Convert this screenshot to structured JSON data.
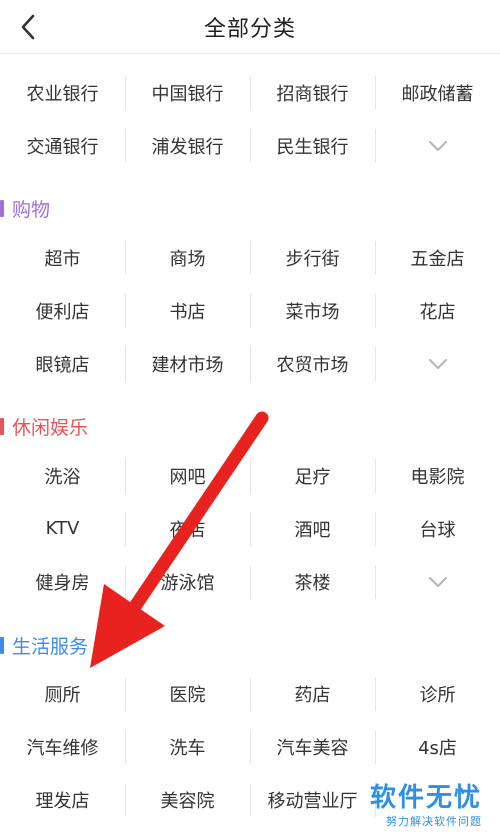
{
  "header": {
    "title": "全部分类",
    "back_icon": "chevron-left-icon"
  },
  "sections": {
    "bank": {
      "rows": [
        [
          "农业银行",
          "中国银行",
          "招商银行",
          "邮政储蓄"
        ],
        [
          "交通银行",
          "浦发银行",
          "民生银行",
          ""
        ]
      ]
    },
    "shopping": {
      "title": "购物",
      "accent": "#a070d8",
      "rows": [
        [
          "超市",
          "商场",
          "步行街",
          "五金店"
        ],
        [
          "便利店",
          "书店",
          "菜市场",
          "花店"
        ],
        [
          "眼镜店",
          "建材市场",
          "农贸市场",
          ""
        ]
      ]
    },
    "leisure": {
      "title": "休闲娱乐",
      "accent": "#e8545a",
      "rows": [
        [
          "洗浴",
          "网吧",
          "足疗",
          "电影院"
        ],
        [
          "KTV",
          "夜店",
          "酒吧",
          "台球"
        ],
        [
          "健身房",
          "游泳馆",
          "茶楼",
          ""
        ]
      ]
    },
    "life": {
      "title": "生活服务",
      "accent": "#3d8be8",
      "rows": [
        [
          "厕所",
          "医院",
          "药店",
          "诊所"
        ],
        [
          "汽车维修",
          "洗车",
          "汽车美容",
          "4s店"
        ],
        [
          "理发店",
          "美容院",
          "移动营业厅",
          ""
        ]
      ]
    }
  },
  "expand_icon": "chevron-down-icon",
  "annotation": {
    "arrow_color": "#e8231f",
    "arrow_icon": "red-arrow-icon"
  },
  "watermark": {
    "main": "软件无忧",
    "sub": "努力解决软件问题"
  }
}
